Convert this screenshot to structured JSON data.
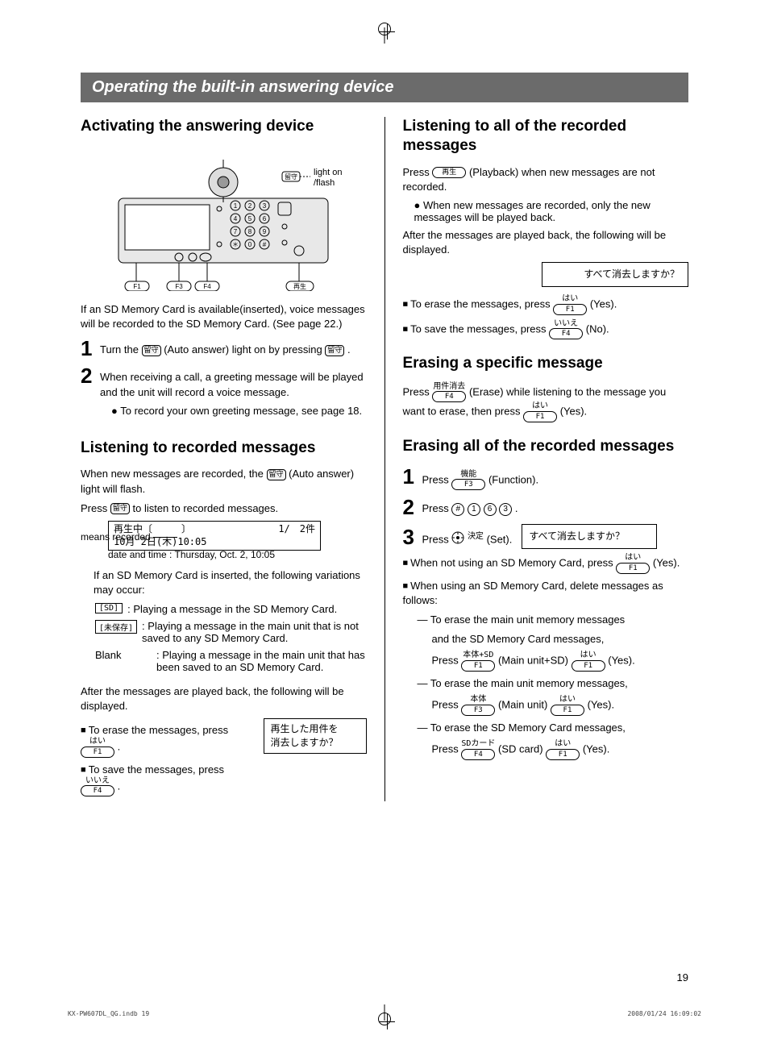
{
  "section_title": "Operating the built-in answering device",
  "left": {
    "h_activate": "Activating the answering device",
    "light_label": "light on\n/flash",
    "sd_note": "If an SD Memory Card is available(inserted), voice messages will be recorded to the SD Memory Card. (See page 22.)",
    "step1": "Turn the ",
    "step1b": " (Auto answer) light on by pressing ",
    "step1_end": ".",
    "step2": "When receiving a call, a greeting message will be played and the unit will record a voice message.",
    "step2_bullet": "To record your own greeting message, see page 18.",
    "h_listen": "Listening to recorded messages",
    "listen_intro": "When new messages are recorded, the ",
    "listen_intro2": " (Auto answer) light will flash.",
    "listen_press": "Press ",
    "listen_press2": " to listen to recorded messages.",
    "lcd_playing": "再生中",
    "lcd_count": "1/　2件",
    "lcd_means": "means recorded",
    "lcd_date_jp": "10月 2日(木)10:05",
    "lcd_date_en": "date and time : Thursday, Oct. 2, 10:05",
    "sd_variations": "If an SD Memory Card is inserted, the following variations may occur:",
    "tag_sd": "[SD]",
    "tag_sd_text": ": Playing a message in the SD Memory Card.",
    "tag_unsaved": "[未保存]",
    "tag_unsaved_text": ": Playing a message in the main unit that is not saved to any SD Memory Card.",
    "tag_blank": "Blank",
    "tag_blank_text": ": Playing a message in the main unit that has been saved to an SD Memory Card.",
    "after_playback": "After the messages are played back, the following will be displayed.",
    "erase_line": "To erase the messages, press ",
    "erase_end": ".",
    "save_line": "To save the messages, press ",
    "save_end": ".",
    "prompt_erase_played": "再生した用件を\n消去しますか？"
  },
  "right": {
    "h_listen_all": "Listening to all of the recorded messages",
    "listen_all_press": "Press ",
    "listen_all_press2": " (Playback) when new messages are not recorded.",
    "listen_all_bullet": "When new messages are recorded, only the new messages will be played back.",
    "after_playback": "After the messages are played back, the following will be displayed.",
    "prompt_erase_all": "すべて消去しますか？",
    "erase_line": "To erase the messages, press ",
    "erase_yes": " (Yes).",
    "save_line": "To save the messages, press ",
    "save_no": " (No).",
    "h_erase_one": "Erasing a specific message",
    "erase_one_press": "Press ",
    "erase_one_mid": " (Erase) while listening to the message you want to erase, then press ",
    "erase_one_end": " (Yes).",
    "h_erase_all": "Erasing all of the recorded messages",
    "s1": "Press ",
    "s1_end": " (Function).",
    "s2": "Press ",
    "s2_end": ".",
    "s3": "Press ",
    "s3_end": " (Set).",
    "when_no_sd": "When not using an SD Memory Card, press ",
    "when_no_sd_end": " (Yes).",
    "when_sd": "When using an SD Memory Card, delete messages as follows:",
    "dash1": "To erase the main unit memory messages",
    "dash1b": "and the SD Memory Card messages,",
    "dash1c": "Press ",
    "dash1c_mid": " (Main unit+SD) ",
    "dash1c_end": " (Yes).",
    "dash2": "To erase the main unit memory messages,",
    "dash2c": "Press ",
    "dash2c_mid": " (Main unit) ",
    "dash2c_end": " (Yes).",
    "dash3": "To erase the SD Memory Card messages,",
    "dash3c": "Press ",
    "dash3c_mid": " (SD card) ",
    "dash3c_end": " (Yes)."
  },
  "keys": {
    "f1": "F1",
    "f3": "F3",
    "f4": "F4",
    "playback": "再生",
    "ans": "留守",
    "hai": "はい",
    "iie": "いいえ",
    "youken": "用件消去",
    "kinou": "機能",
    "kettei": "決定",
    "hontai_sd": "本体+SD",
    "hontai": "本体",
    "sdcard": "SDカード"
  },
  "page_number": "19",
  "footer_left": "KX-PW607DL_QG.indb   19",
  "footer_right": "2008/01/24   16:09:02"
}
